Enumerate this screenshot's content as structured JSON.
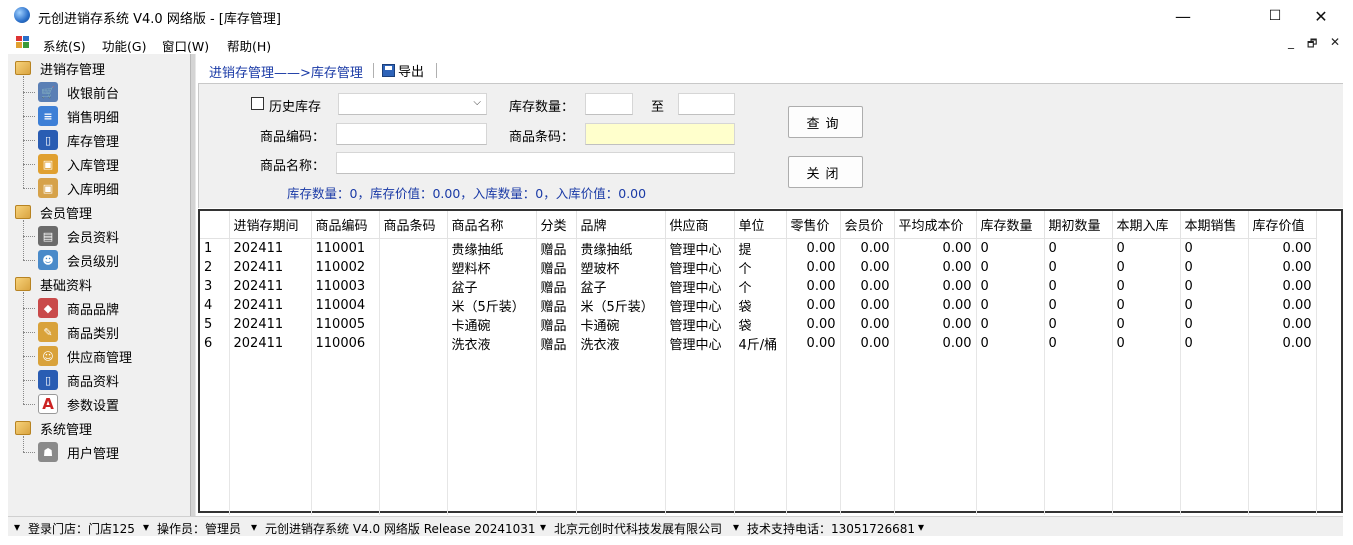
{
  "window": {
    "title": "元创进销存系统 V4.0 网络版  - [库存管理]",
    "min_glyph": "—",
    "max_glyph": "☐",
    "close_glyph": "✕"
  },
  "menu": {
    "items": [
      "系统(S)",
      "功能(G)",
      "窗口(W)",
      "帮助(H)"
    ],
    "mdi_min": "_",
    "mdi_restore": "🗗",
    "mdi_close": "✕"
  },
  "tree": {
    "groups": [
      {
        "label": "进销存管理",
        "children": [
          {
            "label": "收银前台",
            "icon": "cart-icon",
            "color": "#5a7fb5",
            "glyph": "🛒"
          },
          {
            "label": "销售明细",
            "icon": "list-icon",
            "color": "#3d7fd6",
            "glyph": "≡"
          },
          {
            "label": "库存管理",
            "icon": "book-icon",
            "color": "#2a5db3",
            "glyph": "▯"
          },
          {
            "label": "入库管理",
            "icon": "box-in-icon",
            "color": "#e0a030",
            "glyph": "▣"
          },
          {
            "label": "入库明细",
            "icon": "box-detail-icon",
            "color": "#d6a24a",
            "glyph": "▣"
          }
        ]
      },
      {
        "label": "会员管理",
        "children": [
          {
            "label": "会员资料",
            "icon": "member-card-icon",
            "color": "#6b6b6b",
            "glyph": "▤"
          },
          {
            "label": "会员级别",
            "icon": "member-level-icon",
            "color": "#4a8ac9",
            "glyph": "☻"
          }
        ]
      },
      {
        "label": "基础资料",
        "children": [
          {
            "label": "商品品牌",
            "icon": "brand-icon",
            "color": "#c94a4a",
            "glyph": "◆"
          },
          {
            "label": "商品类别",
            "icon": "category-icon",
            "color": "#d9a23a",
            "glyph": "✎"
          },
          {
            "label": "供应商管理",
            "icon": "supplier-icon",
            "color": "#d9a23a",
            "glyph": "☺"
          },
          {
            "label": "商品资料",
            "icon": "goods-icon",
            "color": "#2a5db3",
            "glyph": "▯"
          },
          {
            "label": "参数设置",
            "icon": "params-icon",
            "color": "#ffffff",
            "glyph": "A"
          }
        ]
      },
      {
        "label": "系统管理",
        "children": [
          {
            "label": "用户管理",
            "icon": "user-icon",
            "color": "#8a8a8a",
            "glyph": "☗"
          }
        ]
      }
    ]
  },
  "toolbar": {
    "breadcrumb": "进销存管理——>库存管理",
    "export_label": "导出"
  },
  "filter": {
    "history_label": "历史库存",
    "history_checked": false,
    "qty_label": "库存数量：",
    "qty_from": "",
    "to_label": "至",
    "qty_to": "",
    "code_label": "商品编码：",
    "code_value": "",
    "barcode_label": "商品条码：",
    "barcode_value": "",
    "name_label": "商品名称：",
    "name_value": "",
    "period_select": "",
    "query_button": "查询",
    "close_button": "关闭",
    "summary": "库存数量：0，库存价值：0.00，入库数量：0，入库价值：0.00"
  },
  "grid": {
    "columns": [
      "",
      "进销存期间",
      "商品编码",
      "商品条码",
      "商品名称",
      "分类",
      "品牌",
      "供应商",
      "单位",
      "零售价",
      "会员价",
      "平均成本价",
      "库存数量",
      "期初数量",
      "本期入库",
      "本期销售",
      "库存价值"
    ],
    "rows": [
      [
        "1",
        "202411",
        "110001",
        "",
        "贵缘抽纸",
        "赠品",
        "贵缘抽纸",
        "管理中心",
        "提",
        "0.00",
        "0.00",
        "0.00",
        "0",
        "0",
        "0",
        "0",
        "0.00"
      ],
      [
        "2",
        "202411",
        "110002",
        "",
        "塑料杯",
        "赠品",
        "塑玻杯",
        "管理中心",
        "个",
        "0.00",
        "0.00",
        "0.00",
        "0",
        "0",
        "0",
        "0",
        "0.00"
      ],
      [
        "3",
        "202411",
        "110003",
        "",
        "盆子",
        "赠品",
        "盆子",
        "管理中心",
        "个",
        "0.00",
        "0.00",
        "0.00",
        "0",
        "0",
        "0",
        "0",
        "0.00"
      ],
      [
        "4",
        "202411",
        "110004",
        "",
        "米（5斤装）",
        "赠品",
        "米（5斤装）",
        "管理中心",
        "袋",
        "0.00",
        "0.00",
        "0.00",
        "0",
        "0",
        "0",
        "0",
        "0.00"
      ],
      [
        "5",
        "202411",
        "110005",
        "",
        "卡通碗",
        "赠品",
        "卡通碗",
        "管理中心",
        "袋",
        "0.00",
        "0.00",
        "0.00",
        "0",
        "0",
        "0",
        "0",
        "0.00"
      ],
      [
        "6",
        "202411",
        "110006",
        "",
        "洗衣液",
        "赠品",
        "洗衣液",
        "管理中心",
        "4斤/桶",
        "0.00",
        "0.00",
        "0.00",
        "0",
        "0",
        "0",
        "0",
        "0.00"
      ]
    ]
  },
  "status": {
    "store": "登录门店：门店125",
    "operator": "操作员：管理员",
    "version": "元创进销存系统 V4.0 网络版  Release 20241031",
    "company": "北京元创时代科技发展有限公司",
    "support": "技术支持电话：13051726681",
    "marker": "▾"
  }
}
